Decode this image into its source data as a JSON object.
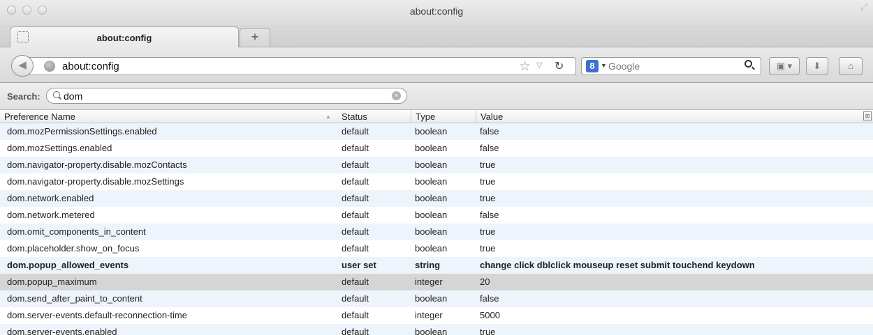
{
  "window": {
    "title": "about:config"
  },
  "tabs": [
    {
      "label": "about:config"
    }
  ],
  "navbar": {
    "url": "about:config",
    "search_engine_name": "Google",
    "search_engine_badge": "8"
  },
  "config_search": {
    "label": "Search:",
    "value": "dom"
  },
  "table": {
    "columns": [
      "Preference Name",
      "Status",
      "Type",
      "Value"
    ],
    "rows": [
      {
        "name": "dom.mozPermissionSettings.enabled",
        "status": "default",
        "type": "boolean",
        "value": "false"
      },
      {
        "name": "dom.mozSettings.enabled",
        "status": "default",
        "type": "boolean",
        "value": "false"
      },
      {
        "name": "dom.navigator-property.disable.mozContacts",
        "status": "default",
        "type": "boolean",
        "value": "true"
      },
      {
        "name": "dom.navigator-property.disable.mozSettings",
        "status": "default",
        "type": "boolean",
        "value": "true"
      },
      {
        "name": "dom.network.enabled",
        "status": "default",
        "type": "boolean",
        "value": "true"
      },
      {
        "name": "dom.network.metered",
        "status": "default",
        "type": "boolean",
        "value": "false"
      },
      {
        "name": "dom.omit_components_in_content",
        "status": "default",
        "type": "boolean",
        "value": "true"
      },
      {
        "name": "dom.placeholder.show_on_focus",
        "status": "default",
        "type": "boolean",
        "value": "true"
      },
      {
        "name": "dom.popup_allowed_events",
        "status": "user set",
        "type": "string",
        "value": "change click dblclick mouseup reset submit touchend keydown"
      },
      {
        "name": "dom.popup_maximum",
        "status": "default",
        "type": "integer",
        "value": "20"
      },
      {
        "name": "dom.send_after_paint_to_content",
        "status": "default",
        "type": "boolean",
        "value": "false"
      },
      {
        "name": "dom.server-events.default-reconnection-time",
        "status": "default",
        "type": "integer",
        "value": "5000"
      },
      {
        "name": "dom.server-events.enabled",
        "status": "default",
        "type": "boolean",
        "value": "true"
      }
    ]
  },
  "icons": {
    "close": "close-icon",
    "minimize": "minimize-icon",
    "zoom": "zoom-icon",
    "back": "back-arrow-icon",
    "bookmark": "star-icon",
    "reload": "reload-icon",
    "search": "magnifier-icon",
    "downloads": "download-arrow-icon",
    "home": "home-icon"
  },
  "colors": {
    "row_alt": "#eef4fb",
    "row_selected": "#d5d5d5",
    "engine_badge": "#3c6fd1"
  }
}
